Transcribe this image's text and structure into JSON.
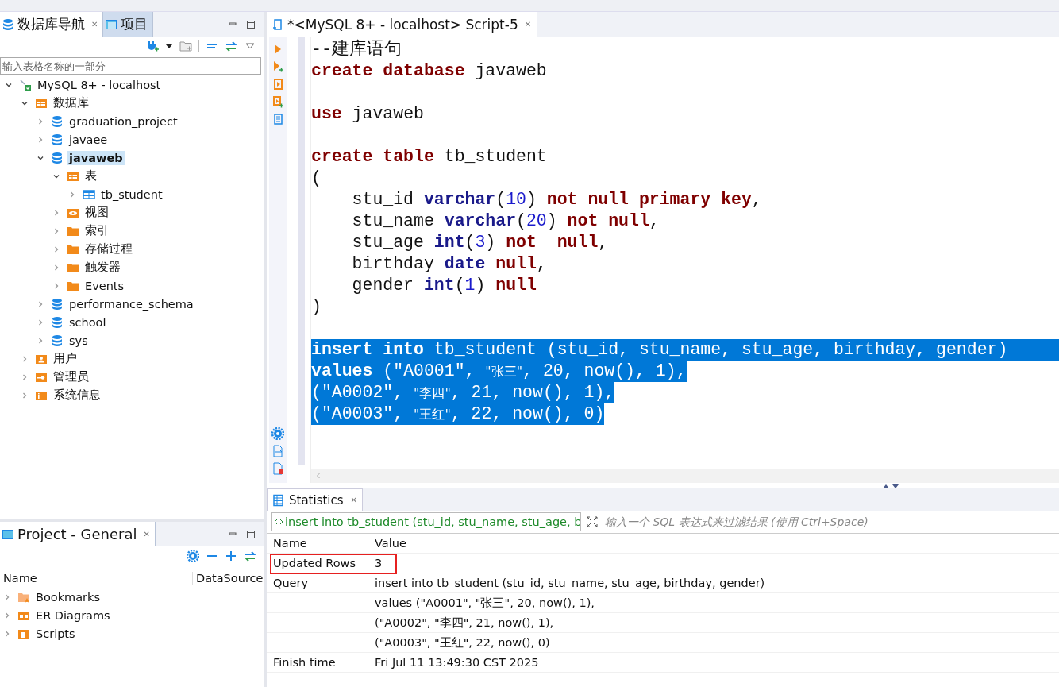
{
  "navigator": {
    "tabs": [
      {
        "label": "数据库导航",
        "selected": true,
        "close": "✕"
      },
      {
        "label": "项目",
        "selected": false
      }
    ],
    "filter": {
      "placeholder": "输入表格名称的一部分"
    },
    "tree": [
      {
        "label": "MySQL 8+ - localhost",
        "kind": "connection",
        "expanded": true,
        "selected": false,
        "children": [
          {
            "label": "数据库",
            "kind": "databases",
            "expanded": true,
            "selected": false,
            "children": [
              {
                "label": "graduation_project",
                "kind": "database",
                "expanded": false,
                "selected": false
              },
              {
                "label": "javaee",
                "kind": "database",
                "expanded": false,
                "selected": false
              },
              {
                "label": "javaweb",
                "kind": "database",
                "expanded": true,
                "selected": true,
                "children": [
                  {
                    "label": "表",
                    "kind": "tables",
                    "expanded": true,
                    "selected": false,
                    "children": [
                      {
                        "label": "tb_student",
                        "kind": "table",
                        "expanded": false,
                        "selected": false
                      }
                    ]
                  },
                  {
                    "label": "视图",
                    "kind": "views",
                    "expanded": false,
                    "selected": false
                  },
                  {
                    "label": "索引",
                    "kind": "folder",
                    "expanded": false,
                    "selected": false
                  },
                  {
                    "label": "存储过程",
                    "kind": "folder",
                    "expanded": false,
                    "selected": false
                  },
                  {
                    "label": "触发器",
                    "kind": "folder",
                    "expanded": false,
                    "selected": false
                  },
                  {
                    "label": "Events",
                    "kind": "folder",
                    "expanded": false,
                    "selected": false
                  }
                ]
              },
              {
                "label": "performance_schema",
                "kind": "database",
                "expanded": false,
                "selected": false
              },
              {
                "label": "school",
                "kind": "database",
                "expanded": false,
                "selected": false
              },
              {
                "label": "sys",
                "kind": "database",
                "expanded": false,
                "selected": false
              }
            ]
          },
          {
            "label": "用户",
            "kind": "users",
            "expanded": false,
            "selected": false
          },
          {
            "label": "管理员",
            "kind": "admins",
            "expanded": false,
            "selected": false
          },
          {
            "label": "系统信息",
            "kind": "info",
            "expanded": false,
            "selected": false
          }
        ]
      }
    ]
  },
  "project_panel": {
    "tab": "Project - General",
    "tab_close": "✕",
    "columns": [
      "Name",
      "DataSource"
    ],
    "items": [
      {
        "label": "Bookmarks",
        "kind": "bookmarks",
        "expanded": false
      },
      {
        "label": "ER Diagrams",
        "kind": "diagrams",
        "expanded": false
      },
      {
        "label": "Scripts",
        "kind": "scripts",
        "expanded": false
      }
    ]
  },
  "editor": {
    "tab": "*<MySQL 8+ - localhost> Script-5",
    "tab_close": "✕",
    "blocks": [
      {
        "lines": [
          {
            "selected": false,
            "tokens": [
              {
                "kind": "comment",
                "text": "--建库语句"
              }
            ]
          },
          {
            "selected": false,
            "tokens": [
              {
                "kind": "kw",
                "text": "create database"
              },
              {
                "kind": "plain",
                "text": " javaweb"
              }
            ]
          }
        ]
      },
      {
        "lines": [
          {
            "selected": false,
            "tokens": [
              {
                "kind": "kw",
                "text": "use"
              },
              {
                "kind": "plain",
                "text": " javaweb"
              }
            ]
          }
        ]
      },
      {
        "lines": [
          {
            "selected": false,
            "tokens": [
              {
                "kind": "kw",
                "text": "create table"
              },
              {
                "kind": "plain",
                "text": " tb_student"
              }
            ]
          },
          {
            "selected": false,
            "tokens": [
              {
                "kind": "plain",
                "text": "("
              }
            ]
          },
          {
            "selected": false,
            "tokens": [
              {
                "kind": "plain",
                "text": "    stu_id "
              },
              {
                "kind": "type",
                "text": "varchar"
              },
              {
                "kind": "plain",
                "text": "("
              },
              {
                "kind": "num",
                "text": "10"
              },
              {
                "kind": "plain",
                "text": ") "
              },
              {
                "kind": "kw",
                "text": "not null primary key"
              },
              {
                "kind": "plain",
                "text": ","
              }
            ]
          },
          {
            "selected": false,
            "tokens": [
              {
                "kind": "plain",
                "text": "    stu_name "
              },
              {
                "kind": "type",
                "text": "varchar"
              },
              {
                "kind": "plain",
                "text": "("
              },
              {
                "kind": "num",
                "text": "20"
              },
              {
                "kind": "plain",
                "text": ") "
              },
              {
                "kind": "kw",
                "text": "not null"
              },
              {
                "kind": "plain",
                "text": ","
              }
            ]
          },
          {
            "selected": false,
            "tokens": [
              {
                "kind": "plain",
                "text": "    stu_age "
              },
              {
                "kind": "type",
                "text": "int"
              },
              {
                "kind": "plain",
                "text": "("
              },
              {
                "kind": "num",
                "text": "3"
              },
              {
                "kind": "plain",
                "text": ") "
              },
              {
                "kind": "kw",
                "text": "not  null"
              },
              {
                "kind": "plain",
                "text": ","
              }
            ]
          },
          {
            "selected": false,
            "tokens": [
              {
                "kind": "plain",
                "text": "    birthday "
              },
              {
                "kind": "type",
                "text": "date"
              },
              {
                "kind": "kw",
                "text": " null"
              },
              {
                "kind": "plain",
                "text": ","
              }
            ]
          },
          {
            "selected": false,
            "tokens": [
              {
                "kind": "plain",
                "text": "    gender "
              },
              {
                "kind": "type",
                "text": "int"
              },
              {
                "kind": "plain",
                "text": "("
              },
              {
                "kind": "num",
                "text": "1"
              },
              {
                "kind": "plain",
                "text": ") "
              },
              {
                "kind": "kw",
                "text": "null"
              }
            ]
          },
          {
            "selected": false,
            "tokens": [
              {
                "kind": "plain",
                "text": ")"
              }
            ]
          }
        ]
      },
      {
        "lines": [
          {
            "selected": true,
            "tokens": [
              {
                "kind": "kw",
                "text": "insert into"
              },
              {
                "kind": "plain",
                "text": " tb_student (stu_id, stu_name, stu_age, birthday, gender)"
              }
            ]
          },
          {
            "selected": true,
            "tokens": [
              {
                "kind": "kw",
                "text": "values"
              },
              {
                "kind": "plain",
                "text": " (\"A0001\", "
              },
              {
                "kind": "zh",
                "text": "\"张三\""
              },
              {
                "kind": "plain",
                "text": ", "
              },
              {
                "kind": "num",
                "text": "20"
              },
              {
                "kind": "plain",
                "text": ", now(), "
              },
              {
                "kind": "num",
                "text": "1"
              },
              {
                "kind": "plain",
                "text": "),"
              }
            ]
          },
          {
            "selected": true,
            "tokens": [
              {
                "kind": "plain",
                "text": "(\"A0002\", "
              },
              {
                "kind": "zh",
                "text": "\"李四\""
              },
              {
                "kind": "plain",
                "text": ", "
              },
              {
                "kind": "num",
                "text": "21"
              },
              {
                "kind": "plain",
                "text": ", now(), "
              },
              {
                "kind": "num",
                "text": "1"
              },
              {
                "kind": "plain",
                "text": "),"
              }
            ]
          },
          {
            "selected": true,
            "tokens": [
              {
                "kind": "plain",
                "text": "(\"A0003\", "
              },
              {
                "kind": "zh",
                "text": "\"王红\""
              },
              {
                "kind": "plain",
                "text": ", "
              },
              {
                "kind": "num",
                "text": "22"
              },
              {
                "kind": "plain",
                "text": ", now(), "
              },
              {
                "kind": "num",
                "text": "0"
              },
              {
                "kind": "plain",
                "text": ")"
              }
            ]
          }
        ]
      }
    ]
  },
  "results": {
    "tab": "Statistics",
    "tab_close": "✕",
    "query": "insert into tb_student (stu_id, stu_name, stu_age, b",
    "filter": {
      "placeholder": "输入一个 SQL 表达式来过滤结果 (使用 Ctrl+Space)"
    },
    "columns": [
      "Name",
      "Value"
    ],
    "rows": [
      {
        "name": "Updated Rows",
        "value": "3",
        "highlighted": true
      },
      {
        "name": "Query",
        "value": "insert into tb_student (stu_id, stu_name, stu_age, birthday, gender)",
        "highlighted": false
      },
      {
        "value": "values (\"A0001\", \"张三\", 20, now(), 1),",
        "highlighted": false
      },
      {
        "value": "(\"A0002\", \"李四\", 21, now(), 1),",
        "highlighted": false
      },
      {
        "value": "(\"A0003\", \"王红\", 22, now(), 0)",
        "highlighted": false
      },
      {
        "name": "Finish time",
        "value": "Fri Jul 11 13:49:30 CST 2025",
        "highlighted": false
      }
    ]
  }
}
